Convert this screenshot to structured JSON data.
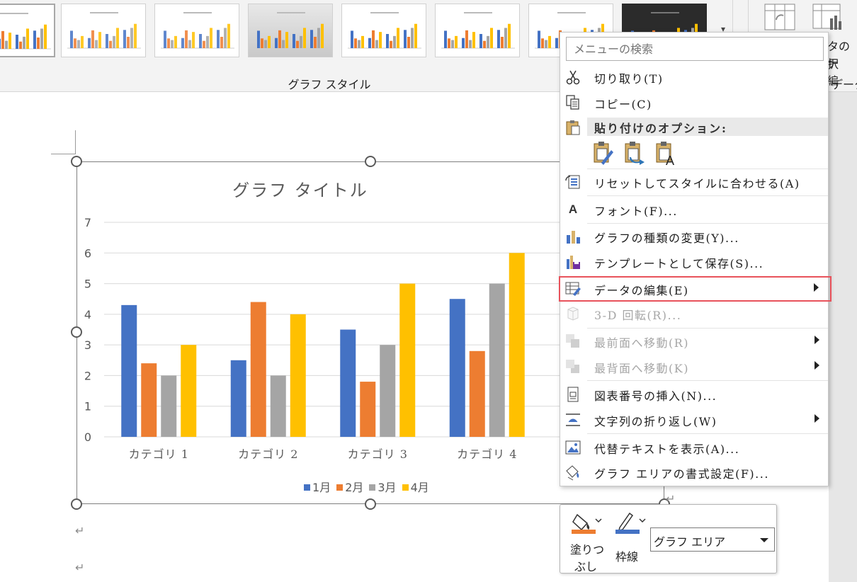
{
  "ribbon": {
    "group_label": "グラフ スタイル",
    "right_group_label": "データ",
    "select_data_text1": "タの　テ",
    "select_data_text2": "択　編"
  },
  "chart_data": {
    "type": "bar",
    "title": "グラフ タイトル",
    "categories": [
      "カテゴリ 1",
      "カテゴリ 2",
      "カテゴリ 3",
      "カテゴリ 4"
    ],
    "series": [
      {
        "name": "1月",
        "color": "#4472c4",
        "values": [
          4.3,
          2.5,
          3.5,
          4.5
        ]
      },
      {
        "name": "2月",
        "color": "#ed7d31",
        "values": [
          2.4,
          4.4,
          1.8,
          2.8
        ]
      },
      {
        "name": "3月",
        "color": "#a5a5a5",
        "values": [
          2.0,
          2.0,
          3.0,
          5.0
        ]
      },
      {
        "name": "4月",
        "color": "#ffc000",
        "values": [
          3.0,
          4.0,
          5.0,
          6.0
        ]
      }
    ],
    "ylim": [
      0,
      7
    ],
    "yticks": [
      "0",
      "1",
      "2",
      "3",
      "4",
      "5",
      "6",
      "7"
    ],
    "grid": true,
    "legend_position": "bottom"
  },
  "document": {
    "paragraph_mark": "↵"
  },
  "context_menu": {
    "search_placeholder": "メニューの検索",
    "paste_options_label": "貼り付けのオプション:",
    "items": {
      "cut": "切り取り(T)",
      "copy": "コピー(C)",
      "reset_style": "リセットしてスタイルに合わせる(A)",
      "font": "フォント(F)...",
      "change_chart_type": "グラフの種類の変更(Y)...",
      "save_template": "テンプレートとして保存(S)...",
      "edit_data": "データの編集(E)",
      "rotation_3d": "3-D 回転(R)...",
      "bring_to_front": "最前面へ移動(R)",
      "send_to_back": "最背面へ移動(K)",
      "insert_caption": "図表番号の挿入(N)...",
      "wrap_text": "文字列の折り返し(W)",
      "view_alt_text": "代替テキストを表示(A)...",
      "format_chart_area": "グラフ エリアの書式設定(F)..."
    },
    "font_icon_glyph": "A"
  },
  "mini_toolbar": {
    "fill_label_line1": "塗りつ",
    "fill_label_line2": "ぶし",
    "fill_color": "#ed7d31",
    "outline_label": "枠線",
    "outline_color": "#4472c4",
    "chart_element_value": "グラフ エリア"
  }
}
